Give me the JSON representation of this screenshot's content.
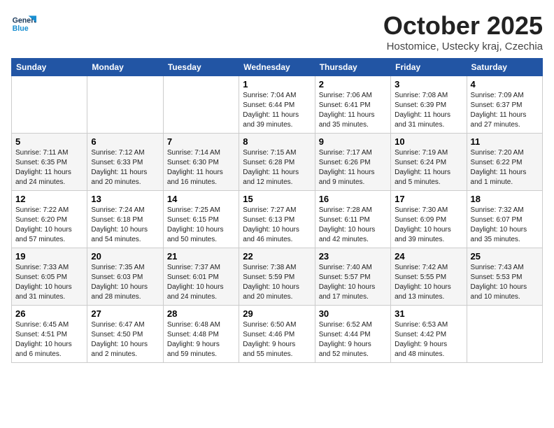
{
  "logo": {
    "line1": "General",
    "line2": "Blue"
  },
  "title": "October 2025",
  "location": "Hostomice, Ustecky kraj, Czechia",
  "headers": [
    "Sunday",
    "Monday",
    "Tuesday",
    "Wednesday",
    "Thursday",
    "Friday",
    "Saturday"
  ],
  "weeks": [
    [
      {
        "day": "",
        "info": ""
      },
      {
        "day": "",
        "info": ""
      },
      {
        "day": "",
        "info": ""
      },
      {
        "day": "1",
        "info": "Sunrise: 7:04 AM\nSunset: 6:44 PM\nDaylight: 11 hours\nand 39 minutes."
      },
      {
        "day": "2",
        "info": "Sunrise: 7:06 AM\nSunset: 6:41 PM\nDaylight: 11 hours\nand 35 minutes."
      },
      {
        "day": "3",
        "info": "Sunrise: 7:08 AM\nSunset: 6:39 PM\nDaylight: 11 hours\nand 31 minutes."
      },
      {
        "day": "4",
        "info": "Sunrise: 7:09 AM\nSunset: 6:37 PM\nDaylight: 11 hours\nand 27 minutes."
      }
    ],
    [
      {
        "day": "5",
        "info": "Sunrise: 7:11 AM\nSunset: 6:35 PM\nDaylight: 11 hours\nand 24 minutes."
      },
      {
        "day": "6",
        "info": "Sunrise: 7:12 AM\nSunset: 6:33 PM\nDaylight: 11 hours\nand 20 minutes."
      },
      {
        "day": "7",
        "info": "Sunrise: 7:14 AM\nSunset: 6:30 PM\nDaylight: 11 hours\nand 16 minutes."
      },
      {
        "day": "8",
        "info": "Sunrise: 7:15 AM\nSunset: 6:28 PM\nDaylight: 11 hours\nand 12 minutes."
      },
      {
        "day": "9",
        "info": "Sunrise: 7:17 AM\nSunset: 6:26 PM\nDaylight: 11 hours\nand 9 minutes."
      },
      {
        "day": "10",
        "info": "Sunrise: 7:19 AM\nSunset: 6:24 PM\nDaylight: 11 hours\nand 5 minutes."
      },
      {
        "day": "11",
        "info": "Sunrise: 7:20 AM\nSunset: 6:22 PM\nDaylight: 11 hours\nand 1 minute."
      }
    ],
    [
      {
        "day": "12",
        "info": "Sunrise: 7:22 AM\nSunset: 6:20 PM\nDaylight: 10 hours\nand 57 minutes."
      },
      {
        "day": "13",
        "info": "Sunrise: 7:24 AM\nSunset: 6:18 PM\nDaylight: 10 hours\nand 54 minutes."
      },
      {
        "day": "14",
        "info": "Sunrise: 7:25 AM\nSunset: 6:15 PM\nDaylight: 10 hours\nand 50 minutes."
      },
      {
        "day": "15",
        "info": "Sunrise: 7:27 AM\nSunset: 6:13 PM\nDaylight: 10 hours\nand 46 minutes."
      },
      {
        "day": "16",
        "info": "Sunrise: 7:28 AM\nSunset: 6:11 PM\nDaylight: 10 hours\nand 42 minutes."
      },
      {
        "day": "17",
        "info": "Sunrise: 7:30 AM\nSunset: 6:09 PM\nDaylight: 10 hours\nand 39 minutes."
      },
      {
        "day": "18",
        "info": "Sunrise: 7:32 AM\nSunset: 6:07 PM\nDaylight: 10 hours\nand 35 minutes."
      }
    ],
    [
      {
        "day": "19",
        "info": "Sunrise: 7:33 AM\nSunset: 6:05 PM\nDaylight: 10 hours\nand 31 minutes."
      },
      {
        "day": "20",
        "info": "Sunrise: 7:35 AM\nSunset: 6:03 PM\nDaylight: 10 hours\nand 28 minutes."
      },
      {
        "day": "21",
        "info": "Sunrise: 7:37 AM\nSunset: 6:01 PM\nDaylight: 10 hours\nand 24 minutes."
      },
      {
        "day": "22",
        "info": "Sunrise: 7:38 AM\nSunset: 5:59 PM\nDaylight: 10 hours\nand 20 minutes."
      },
      {
        "day": "23",
        "info": "Sunrise: 7:40 AM\nSunset: 5:57 PM\nDaylight: 10 hours\nand 17 minutes."
      },
      {
        "day": "24",
        "info": "Sunrise: 7:42 AM\nSunset: 5:55 PM\nDaylight: 10 hours\nand 13 minutes."
      },
      {
        "day": "25",
        "info": "Sunrise: 7:43 AM\nSunset: 5:53 PM\nDaylight: 10 hours\nand 10 minutes."
      }
    ],
    [
      {
        "day": "26",
        "info": "Sunrise: 6:45 AM\nSunset: 4:51 PM\nDaylight: 10 hours\nand 6 minutes."
      },
      {
        "day": "27",
        "info": "Sunrise: 6:47 AM\nSunset: 4:50 PM\nDaylight: 10 hours\nand 2 minutes."
      },
      {
        "day": "28",
        "info": "Sunrise: 6:48 AM\nSunset: 4:48 PM\nDaylight: 9 hours\nand 59 minutes."
      },
      {
        "day": "29",
        "info": "Sunrise: 6:50 AM\nSunset: 4:46 PM\nDaylight: 9 hours\nand 55 minutes."
      },
      {
        "day": "30",
        "info": "Sunrise: 6:52 AM\nSunset: 4:44 PM\nDaylight: 9 hours\nand 52 minutes."
      },
      {
        "day": "31",
        "info": "Sunrise: 6:53 AM\nSunset: 4:42 PM\nDaylight: 9 hours\nand 48 minutes."
      },
      {
        "day": "",
        "info": ""
      }
    ]
  ]
}
